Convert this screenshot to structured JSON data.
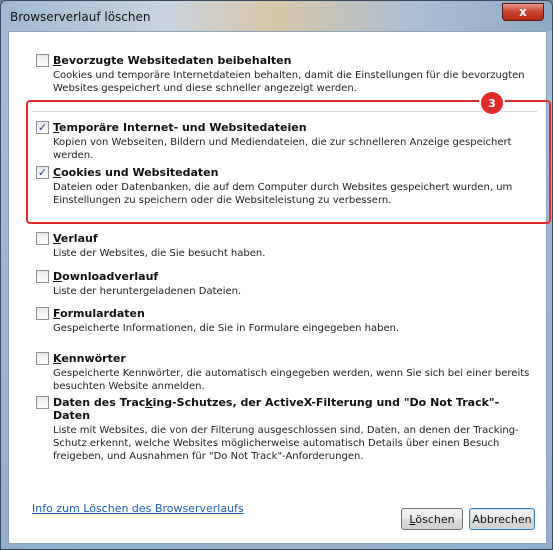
{
  "window": {
    "title": "Browserverlauf löschen",
    "close_glyph": "x"
  },
  "options": [
    {
      "key": "favorites",
      "checked": false,
      "accel": "B",
      "title_rest": "evorzugte Websitedaten beibehalten",
      "desc": "Cookies und temporäre Internetdateien behalten, damit die Einstellungen für die bevorzugten Websites gespeichert und diese schneller angezeigt werden."
    },
    {
      "key": "temp",
      "checked": true,
      "accel": "T",
      "title_rest": "emporäre Internet- und Websitedateien",
      "desc": "Kopien von Webseiten, Bildern und Mediendateien, die zur schnelleren Anzeige gespeichert werden."
    },
    {
      "key": "cookies",
      "checked": true,
      "accel": "C",
      "title_rest": "ookies und Websitedaten",
      "desc": "Dateien oder Datenbanken, die auf dem Computer durch Websites gespeichert wurden, um Einstellungen zu speichern oder die Websiteleistung zu verbessern."
    },
    {
      "key": "history",
      "checked": false,
      "accel": "V",
      "title_rest": "erlauf",
      "desc": "Liste der Websites, die Sie besucht haben."
    },
    {
      "key": "downloads",
      "checked": false,
      "accel": "D",
      "title_rest": "ownloadverlauf",
      "desc": "Liste der heruntergeladenen Dateien."
    },
    {
      "key": "forms",
      "checked": false,
      "accel": "F",
      "title_rest": "ormulardaten",
      "desc": "Gespeicherte Informationen, die Sie in Formulare eingegeben haben."
    },
    {
      "key": "passwords",
      "checked": false,
      "accel": "K",
      "title_rest": "ennwörter",
      "desc": "Gespeicherte Kennwörter, die automatisch eingegeben werden, wenn Sie sich bei einer bereits besuchten Website anmelden."
    },
    {
      "key": "tracking",
      "checked": false,
      "title_pre": "Daten des Trac",
      "accel": "k",
      "title_rest": "ing-Schutzes, der ActiveX-Filterung und \"Do Not Track\"-Daten",
      "desc": "Liste mit Websites, die von der Filterung ausgeschlossen sind, Daten, an denen der Tracking-Schutz erkennt, welche Websites möglicherweise automatisch Details über einen Besuch freigeben, und Ausnahmen für \"Do Not Track\"-Anforderungen."
    }
  ],
  "annotation": {
    "badge": "3",
    "color": "#e12b2b"
  },
  "footer": {
    "info_link": "Info zum Löschen des Browserverlaufs",
    "delete_accel": "L",
    "delete_rest": "öschen",
    "cancel_label": "Abbrechen"
  },
  "check_glyph": "✓"
}
